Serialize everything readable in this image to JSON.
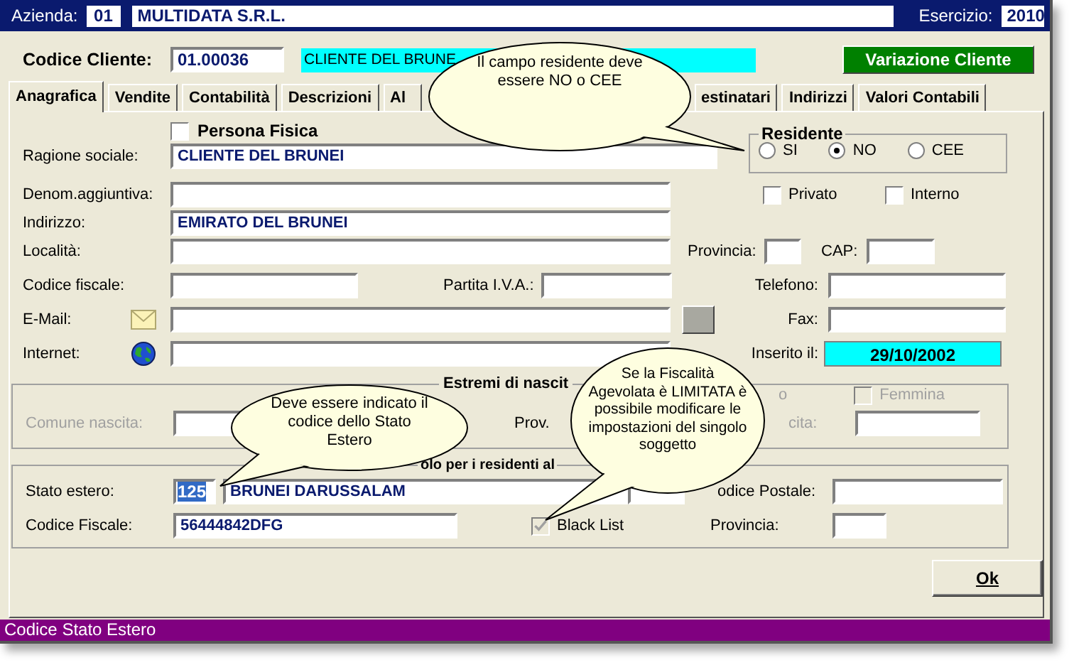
{
  "header": {
    "company_label": "Azienda:",
    "company_code": "01",
    "company_name": "MULTIDATA S.R.L.",
    "year_label": "Esercizio:",
    "year": "2010"
  },
  "customer": {
    "label": "Codice Cliente:",
    "code": "01.00036",
    "name": "CLIENTE DEL BRUNE"
  },
  "action_button": "Variazione Cliente",
  "tabs": [
    {
      "label": "Anagrafica",
      "selected": true
    },
    {
      "label": "Vendite",
      "selected": false
    },
    {
      "label": "Contabilità",
      "selected": false
    },
    {
      "label": "Descrizioni",
      "selected": false
    },
    {
      "label": "Al",
      "selected": false
    },
    {
      "label": "estinatari",
      "selected": false
    },
    {
      "label": "Indirizzi",
      "selected": false
    },
    {
      "label": "Valori Contabili",
      "selected": false
    }
  ],
  "persona_fisica": {
    "label": "Persona Fisica",
    "checked": false
  },
  "residente": {
    "title": "Residente",
    "options": [
      {
        "label": "SI",
        "selected": false
      },
      {
        "label": "NO",
        "selected": true
      },
      {
        "label": "CEE",
        "selected": false
      }
    ]
  },
  "form": {
    "ragione_sociale": {
      "label": "Ragione sociale:",
      "value": "CLIENTE DEL BRUNEI"
    },
    "denom": {
      "label": "Denom.aggiuntiva:"
    },
    "privato": {
      "label": "Privato",
      "checked": false
    },
    "interno": {
      "label": "Interno",
      "checked": false
    },
    "indirizzo": {
      "label": "Indirizzo:",
      "value": "EMIRATO DEL BRUNEI"
    },
    "localita": {
      "label": "Località:"
    },
    "provincia": {
      "label": "Provincia:"
    },
    "cap": {
      "label": "CAP:"
    },
    "codice_fiscale": {
      "label": "Codice fiscale:"
    },
    "partita_iva": {
      "label": "Partita I.V.A.:"
    },
    "telefono": {
      "label": "Telefono:"
    },
    "email": {
      "label": "E-Mail:"
    },
    "fax": {
      "label": "Fax:"
    },
    "internet": {
      "label": "Internet:"
    },
    "inserito": {
      "label": "Inserito il:",
      "value": "29/10/2002"
    }
  },
  "nascita": {
    "title": "Estremi di nascit",
    "disabled": true,
    "comune_label": "Comune nascita:",
    "prov_label": "Prov.",
    "sex_tail": "o",
    "femmina": {
      "label": "Femmina",
      "checked": false
    },
    "date_tail": "cita:"
  },
  "esteri": {
    "title": "olo per i residenti al",
    "stato_label": "Stato estero:",
    "stato_code": "125",
    "stato_code_selected": true,
    "stato_name": "BRUNEI DARUSSALAM",
    "cf_label": "Codice Fiscale:",
    "cf_value": "56444842DFG",
    "black_list": {
      "label": "Black List",
      "checked": true,
      "disabled": true
    },
    "postal_label": "odice Postale:",
    "prov_label": "Provincia:"
  },
  "callouts": [
    {
      "text": "Il campo residente deve essere NO o CEE"
    },
    {
      "text": "Deve essere indicato il codice dello Stato Estero"
    },
    {
      "text": "Se la Fiscalità Agevolata è LIMITATA è possibile modificare le impostazioni del singolo soggetto"
    }
  ],
  "ok_button": "Ok",
  "status_bar": "Codice Stato Estero"
}
